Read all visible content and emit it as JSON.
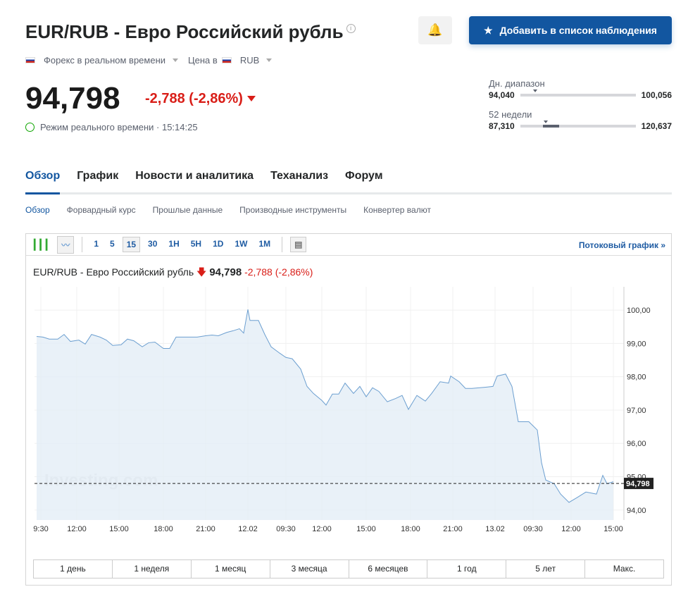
{
  "header": {
    "title": "EUR/RUB - Евро Российский рубль",
    "info_icon": "i",
    "market": "Форекс в реальном времени",
    "price_in_label": "Цена в",
    "currency": "RUB",
    "price": "94,798",
    "change": "-2,788",
    "change_pct": "(-2,86%)",
    "realtime_label": "Режим реального времени · 15:14:25",
    "watchlist_button": "Добавить в список наблюдения",
    "alert_icon": "bell-plus-icon"
  },
  "ranges": {
    "day": {
      "label": "Дн. диапазон",
      "low": "94,040",
      "high": "100,056",
      "position": 0.13
    },
    "week52": {
      "label": "52 недели",
      "low": "87,310",
      "high": "120,637",
      "position": 0.22
    }
  },
  "tabs": [
    "Обзор",
    "График",
    "Новости и аналитика",
    "Теханализ",
    "Форум"
  ],
  "subtabs": [
    "Обзор",
    "Форвардный курс",
    "Прошлые данные",
    "Производные инструменты",
    "Конвертер валют"
  ],
  "toolbar": {
    "intervals": [
      "1",
      "5",
      "15",
      "30",
      "1H",
      "5H",
      "1D",
      "1W",
      "1M"
    ],
    "selected": "15",
    "streaming": "Потоковый график »"
  },
  "chart_title": {
    "name": "EUR/RUB - Евро Российский рубль",
    "price": "94,798",
    "change": "-2,788",
    "change_pct": "(-2,86%)"
  },
  "periods": [
    "1 день",
    "1 неделя",
    "1 месяц",
    "3 месяца",
    "6 месяцев",
    "1 год",
    "5 лет",
    "Макс."
  ],
  "colors": {
    "accent": "#1256a0",
    "down": "#d91e18",
    "line": "#6c9fd0",
    "fill": "#e4edf6"
  },
  "chart_data": {
    "type": "area",
    "watermark": "Investing.com",
    "current_label": "94,798",
    "current": 94.798,
    "ylim": [
      93.7,
      100.7
    ],
    "yticks": [
      94,
      95,
      96,
      97,
      98,
      99,
      100
    ],
    "ytick_labels": [
      "94,00",
      "95,00",
      "96,00",
      "97,00",
      "98,00",
      "99,00",
      "100,00"
    ],
    "xlim": [
      0,
      279
    ],
    "xticks": [
      {
        "x": 3,
        "label": "9:30"
      },
      {
        "x": 20,
        "label": "12:00"
      },
      {
        "x": 40,
        "label": "15:00"
      },
      {
        "x": 61,
        "label": "18:00"
      },
      {
        "x": 81,
        "label": "21:00"
      },
      {
        "x": 101,
        "label": "12.02"
      },
      {
        "x": 119,
        "label": "09:30"
      },
      {
        "x": 136,
        "label": "12:00"
      },
      {
        "x": 157,
        "label": "15:00"
      },
      {
        "x": 178,
        "label": "18:00"
      },
      {
        "x": 198,
        "label": "21:00"
      },
      {
        "x": 218,
        "label": "13.02"
      },
      {
        "x": 236,
        "label": "09:30"
      },
      {
        "x": 254,
        "label": "12:00"
      },
      {
        "x": 274,
        "label": "15:00"
      }
    ],
    "points": [
      [
        1,
        99.21
      ],
      [
        4,
        99.19
      ],
      [
        7,
        99.13
      ],
      [
        11,
        99.13
      ],
      [
        14,
        99.27
      ],
      [
        17,
        99.06
      ],
      [
        21,
        99.1
      ],
      [
        24,
        98.98
      ],
      [
        27,
        99.27
      ],
      [
        31,
        99.19
      ],
      [
        34,
        99.1
      ],
      [
        37,
        98.94
      ],
      [
        41,
        98.96
      ],
      [
        44,
        99.13
      ],
      [
        47,
        99.08
      ],
      [
        51,
        98.9
      ],
      [
        54,
        99.02
      ],
      [
        57,
        99.04
      ],
      [
        61,
        98.85
      ],
      [
        64,
        98.85
      ],
      [
        67,
        99.19
      ],
      [
        71,
        99.19
      ],
      [
        74,
        99.19
      ],
      [
        77,
        99.19
      ],
      [
        81,
        99.23
      ],
      [
        84,
        99.25
      ],
      [
        87,
        99.23
      ],
      [
        91,
        99.33
      ],
      [
        94,
        99.38
      ],
      [
        97,
        99.44
      ],
      [
        99,
        99.31
      ],
      [
        101,
        100.02
      ],
      [
        102,
        99.69
      ],
      [
        106,
        99.69
      ],
      [
        109,
        99.27
      ],
      [
        112,
        98.9
      ],
      [
        116,
        98.71
      ],
      [
        119,
        98.58
      ],
      [
        122,
        98.54
      ],
      [
        126,
        98.23
      ],
      [
        129,
        97.71
      ],
      [
        132,
        97.5
      ],
      [
        136,
        97.29
      ],
      [
        138,
        97.15
      ],
      [
        141,
        97.48
      ],
      [
        144,
        97.48
      ],
      [
        147,
        97.81
      ],
      [
        151,
        97.5
      ],
      [
        154,
        97.71
      ],
      [
        157,
        97.4
      ],
      [
        160,
        97.67
      ],
      [
        163,
        97.56
      ],
      [
        167,
        97.25
      ],
      [
        171,
        97.35
      ],
      [
        174,
        97.44
      ],
      [
        177,
        97.02
      ],
      [
        181,
        97.44
      ],
      [
        185,
        97.27
      ],
      [
        188,
        97.5
      ],
      [
        192,
        97.85
      ],
      [
        196,
        97.81
      ],
      [
        197,
        98.02
      ],
      [
        201,
        97.85
      ],
      [
        204,
        97.65
      ],
      [
        207,
        97.65
      ],
      [
        214,
        97.69
      ],
      [
        217,
        97.71
      ],
      [
        219,
        98.02
      ],
      [
        223,
        98.08
      ],
      [
        226,
        97.71
      ],
      [
        229,
        96.65
      ],
      [
        234,
        96.65
      ],
      [
        238,
        96.4
      ],
      [
        240,
        95.42
      ],
      [
        242,
        94.9
      ],
      [
        246,
        94.79
      ],
      [
        249,
        94.48
      ],
      [
        253,
        94.23
      ],
      [
        257,
        94.38
      ],
      [
        261,
        94.54
      ],
      [
        266,
        94.48
      ],
      [
        269,
        95.04
      ],
      [
        271,
        94.79
      ],
      [
        274,
        94.85
      ]
    ]
  }
}
